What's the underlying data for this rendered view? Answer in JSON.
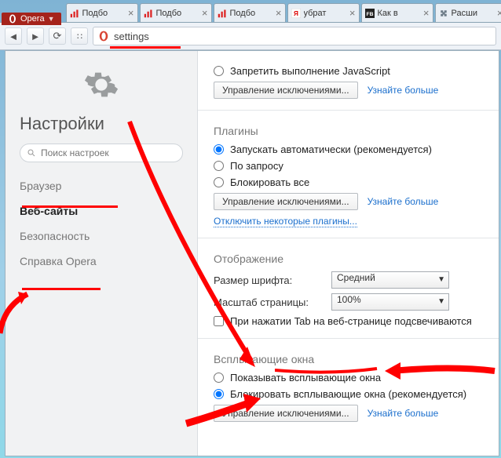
{
  "app_name": "Opera",
  "tabs": [
    {
      "title": "Подбо",
      "fav": "bars-red"
    },
    {
      "title": "Подбо",
      "fav": "bars-red"
    },
    {
      "title": "Подбо",
      "fav": "bars-red"
    },
    {
      "title": "убрат",
      "fav": "yandex"
    },
    {
      "title": "Как в",
      "fav": "fb"
    },
    {
      "title": "Расши",
      "fav": "puzzle"
    }
  ],
  "address_value": "settings",
  "sidebar": {
    "title": "Настройки",
    "search_placeholder": "Поиск настроек",
    "items": [
      "Браузер",
      "Веб-сайты",
      "Безопасность",
      "Справка Opera"
    ],
    "active_index": 1
  },
  "js": {
    "deny": "Запретить выполнение JavaScript",
    "manage": "Управление исключениями...",
    "more": "Узнайте больше"
  },
  "plugins": {
    "title": "Плагины",
    "auto": "Запускать автоматически (рекомендуется)",
    "ondemand": "По запросу",
    "blockall": "Блокировать все",
    "manage": "Управление исключениями...",
    "more": "Узнайте больше",
    "disable": "Отключить некоторые плагины..."
  },
  "display": {
    "title": "Отображение",
    "fontsize_label": "Размер шрифта:",
    "fontsize_value": "Средний",
    "zoom_label": "Масштаб страницы:",
    "zoom_value": "100%",
    "tab_highlight": "При нажатии Tab на веб-странице подсвечиваются"
  },
  "popups": {
    "title": "Всплывающие окна",
    "show": "Показывать всплывающие окна",
    "block": "Блокировать всплывающие окна (рекомендуется)",
    "manage": "Управление исключениями...",
    "more": "Узнайте больше"
  }
}
